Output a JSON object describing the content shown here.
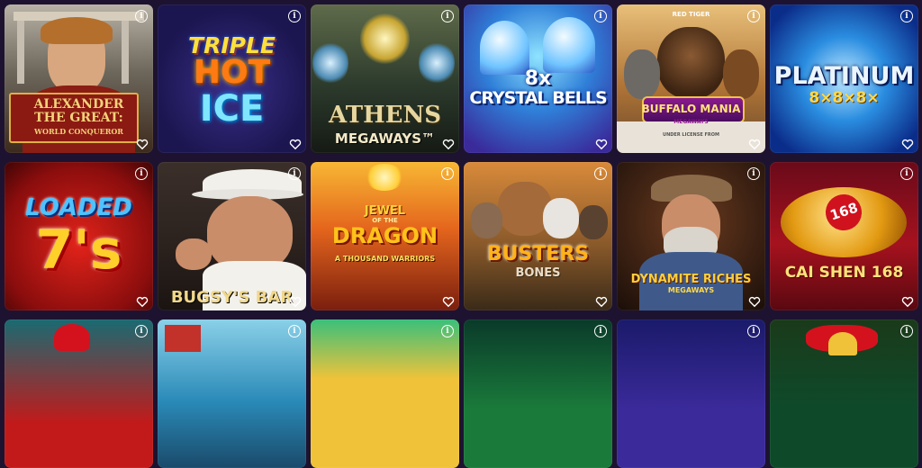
{
  "games": [
    {
      "title_lines": [
        "ALEXANDER",
        "THE GREAT:"
      ],
      "subtitle": "WORLD CONQUEROR"
    },
    {
      "title_lines": [
        "TRIPLE",
        "HOT",
        "ICE"
      ]
    },
    {
      "title_lines": [
        "ATHENS"
      ],
      "subtitle": "MEGAWAYS™"
    },
    {
      "title_lines": [
        "8x",
        "CRYSTAL BELLS"
      ]
    },
    {
      "title_lines": [
        "BUFFALO MANIA"
      ],
      "subtitle": "MEGAWAYS",
      "brand": "RED TIGER",
      "note": "UNDER LICENSE FROM"
    },
    {
      "title_lines": [
        "PLATINUM",
        "8×8×8×"
      ]
    },
    {
      "title_lines": [
        "LOADED",
        "7's"
      ]
    },
    {
      "title_lines": [
        "BUGSY'S BAR"
      ]
    },
    {
      "title_lines": [
        "JEWEL",
        "OF THE",
        "DRAGON"
      ],
      "subtitle": "A THOUSAND WARRIORS"
    },
    {
      "title_lines": [
        "BUSTERS",
        "BONES"
      ]
    },
    {
      "title_lines": [
        "DYNAMITE RICHES"
      ],
      "subtitle": "MEGAWAYS"
    },
    {
      "title_lines": [
        "CAI SHEN 168"
      ],
      "badge": "168"
    },
    {
      "title_lines": []
    },
    {
      "title_lines": []
    },
    {
      "title_lines": []
    },
    {
      "title_lines": []
    },
    {
      "title_lines": []
    },
    {
      "title_lines": []
    }
  ],
  "icons": {
    "info": "info-icon",
    "favorite": "heart-icon"
  },
  "info_glyph": "i"
}
